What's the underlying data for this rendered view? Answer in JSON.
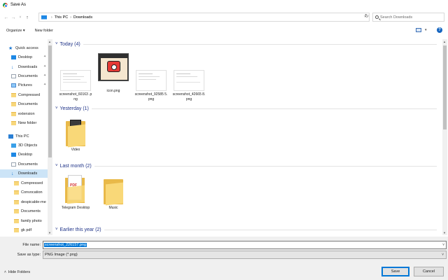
{
  "window": {
    "title": "Save As"
  },
  "nav": {
    "breadcrumb": [
      "This PC",
      "Downloads"
    ],
    "search_placeholder": "Search Downloads"
  },
  "toolbar": {
    "organize_label": "Organize ▾",
    "new_folder_label": "New folder",
    "help_label": "?"
  },
  "sidebar": {
    "items": [
      {
        "label": "Quick access",
        "icon": "star-icon"
      },
      {
        "label": "Desktop",
        "icon": "desktop-icon"
      },
      {
        "label": "Downloads",
        "icon": "download-icon"
      },
      {
        "label": "Documents",
        "icon": "document-icon"
      },
      {
        "label": "Pictures",
        "icon": "pictures-icon"
      },
      {
        "label": "Compressed",
        "icon": "folder-icon"
      },
      {
        "label": "Documents",
        "icon": "folder-icon"
      },
      {
        "label": "extension",
        "icon": "folder-icon"
      },
      {
        "label": "New folder",
        "icon": "folder-icon"
      },
      {
        "label": "This PC",
        "icon": "computer-icon"
      },
      {
        "label": "3D Objects",
        "icon": "3d-objects-icon"
      },
      {
        "label": "Desktop",
        "icon": "desktop-icon"
      },
      {
        "label": "Documents",
        "icon": "document-icon"
      },
      {
        "label": "Downloads",
        "icon": "download-icon"
      },
      {
        "label": "Compressed",
        "icon": "folder-icon"
      },
      {
        "label": "Convocation",
        "icon": "folder-icon"
      },
      {
        "label": "despicable-me",
        "icon": "folder-icon"
      },
      {
        "label": "Documents",
        "icon": "folder-icon"
      },
      {
        "label": "family photo",
        "icon": "folder-icon"
      },
      {
        "label": "gk pdf",
        "icon": "folder-icon"
      }
    ]
  },
  "groups": [
    {
      "label": "Today (4)"
    },
    {
      "label": "Yesterday (1)"
    },
    {
      "label": "Last month (2)"
    },
    {
      "label": "Earlier this year (2)"
    }
  ],
  "files": {
    "today": [
      {
        "name": "screenshot_60163 .png"
      },
      {
        "name": "icon.png"
      },
      {
        "name": "screenshot_92585 5.png"
      },
      {
        "name": "screenshot_42665 8.png"
      }
    ],
    "yesterday": [
      {
        "name": "Video"
      }
    ],
    "last_month": [
      {
        "name": "Telegram Desktop"
      },
      {
        "name": "Music"
      }
    ]
  },
  "form": {
    "file_name_label": "File name:",
    "file_name_value": "screenshot_226157.png",
    "save_type_label": "Save as type:",
    "save_type_value": "PNG Image (*.png)"
  },
  "footer": {
    "hide_folders_label": "Hide Folders",
    "save_label": "Save",
    "cancel_label": "Cancel"
  },
  "colors": {
    "accent": "#0078d7",
    "group_header": "#1e3287",
    "selected_nav": "#cce4f7"
  }
}
